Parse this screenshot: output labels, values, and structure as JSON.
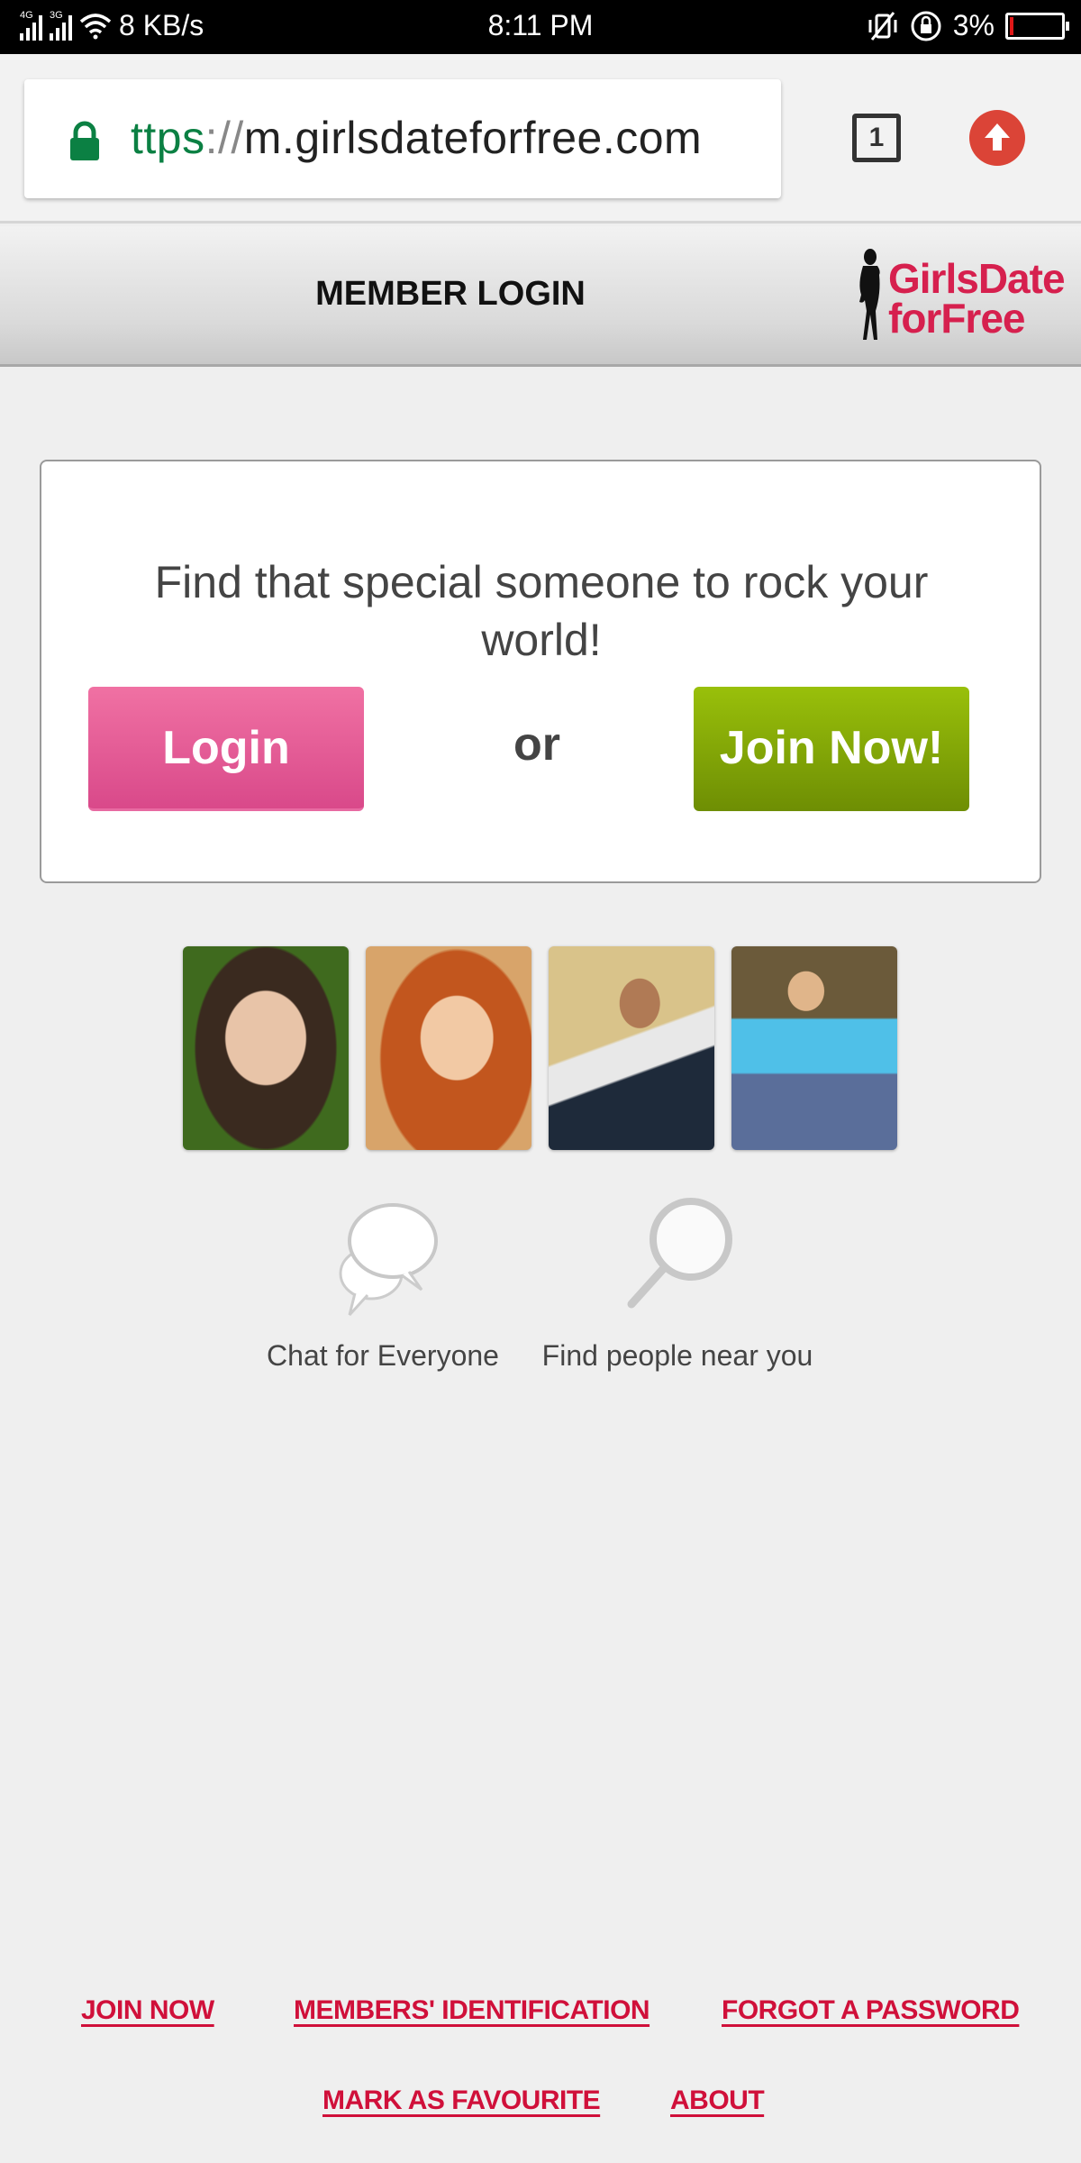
{
  "status_bar": {
    "network_1": "4G",
    "network_2": "3G",
    "speed": "8 KB/s",
    "time": "8:11 PM",
    "battery": "3%",
    "icons": [
      "signal-4g-icon",
      "signal-3g-icon",
      "wifi-icon",
      "vibrate-mute-icon",
      "rotation-lock-icon",
      "battery-icon"
    ]
  },
  "browser": {
    "url_scheme": "ttps",
    "url_separator": "://",
    "url_host": "m.girlsdateforfree.com",
    "tab_count": "1",
    "icons": [
      "lock-icon",
      "tabs-icon",
      "update-icon"
    ],
    "colors": {
      "secure": "#0b8043",
      "update": "#db4437"
    }
  },
  "site_header": {
    "title": "MEMBER LOGIN",
    "logo_line1": "GirlsDate",
    "logo_line2": "forFree",
    "logo_color": "#d6204e"
  },
  "hero": {
    "tagline": "Find that special someone to rock your world!",
    "login_label": "Login",
    "or_label": "or",
    "join_label": "Join Now!",
    "colors": {
      "login": "#e05a96",
      "join": "#86a808"
    }
  },
  "photos": [
    {
      "alt": "member-photo-1"
    },
    {
      "alt": "member-photo-2"
    },
    {
      "alt": "member-photo-3"
    },
    {
      "alt": "member-photo-4"
    }
  ],
  "features": [
    {
      "icon": "chat-bubbles-icon",
      "label": "Chat for Everyone"
    },
    {
      "icon": "magnifier-icon",
      "label": "Find people near you"
    }
  ],
  "footer": {
    "links": [
      "JOIN NOW",
      "MEMBERS' IDENTIFICATION",
      "FORGOT A PASSWORD",
      "MARK AS FAVOURITE",
      "ABOUT"
    ],
    "link_color": "#d0103a"
  }
}
